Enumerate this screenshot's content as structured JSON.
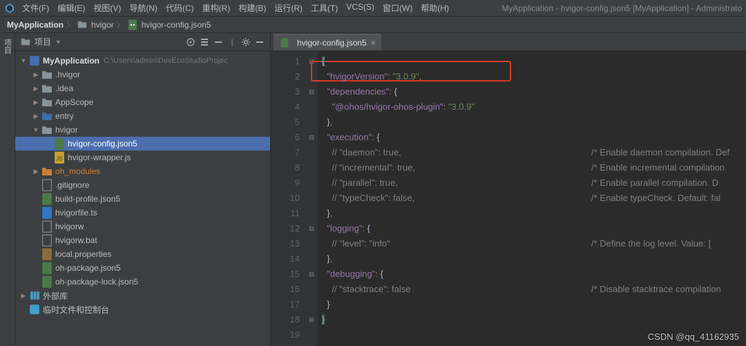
{
  "window_title": "MyApplication - hvigor-config.json5 [MyApplication] - Administrato",
  "menu": {
    "file": "文件(F)",
    "edit": "编辑(E)",
    "view": "视图(V)",
    "navigate": "导航(N)",
    "code": "代码(C)",
    "refactor": "重构(R)",
    "build": "构建(B)",
    "run": "运行(R)",
    "tool": "工具(T)",
    "vcs": "VCS(S)",
    "window": "窗口(W)",
    "help": "帮助(H)"
  },
  "breadcrumb": {
    "root": "MyApplication",
    "mid": "hvigor",
    "leaf": "hvigor-config.json5"
  },
  "side_tab_label": "项目",
  "project_panel_label": "项目",
  "tree": {
    "root_name": "MyApplication",
    "root_path": "C:\\Users\\admin\\DevEcoStudioProjec",
    "hvigor_dir": ".hvigor",
    "idea_dir": ".idea",
    "appscope": "AppScope",
    "entry": "entry",
    "hvigor": "hvigor",
    "hvigor_config": "hvigor-config.json5",
    "hvigor_wrapper": "hvigor-wrapper.js",
    "oh_modules": "oh_modules",
    "gitignore": ".gitignore",
    "build_profile": "build-profile.json5",
    "hvigorfile_ts": "hvigorfile.ts",
    "hvigorw": "hvigorw",
    "hvigorw_bat": "hvigorw.bat",
    "local_props": "local.properties",
    "oh_package": "oh-package.json5",
    "oh_package_lock": "oh-package-lock.json5",
    "ext_libs": "外部库",
    "scratch": "临时文件和控制台"
  },
  "editor": {
    "tab_label": "hvigor-config.json5",
    "lines": {
      "l1": "{",
      "l2_key": "\"hvigorVersion\"",
      "l2_val": "\"3.0.9\"",
      "l3_key": "\"dependencies\"",
      "l4_key": "\"@ohos/hvigor-ohos-plugin\"",
      "l4_val": "\"3.0.9\"",
      "l6_key": "\"execution\"",
      "l7_c": "// \"daemon\": true,",
      "l7_r": "/* Enable daemon compilation. Def",
      "l8_c": "// \"incremental\": true,",
      "l8_r": "/* Enable incremental compilation",
      "l9_c": "// \"parallel\": true,",
      "l9_r": "/* Enable parallel compilation. D",
      "l10_c": "// \"typeCheck\": false,",
      "l10_r": "/* Enable typeCheck. Default: fal",
      "l12_key": "\"logging\"",
      "l13_c": "// \"level\": \"info\"",
      "l13_r": "/* Define the log level. Value: [",
      "l15_key": "\"debugging\"",
      "l16_c": "// \"stacktrace\": false",
      "l16_r": "/* Disable stacktrace compilation",
      "l18": "}"
    }
  },
  "watermark": "CSDN @qq_41162935"
}
